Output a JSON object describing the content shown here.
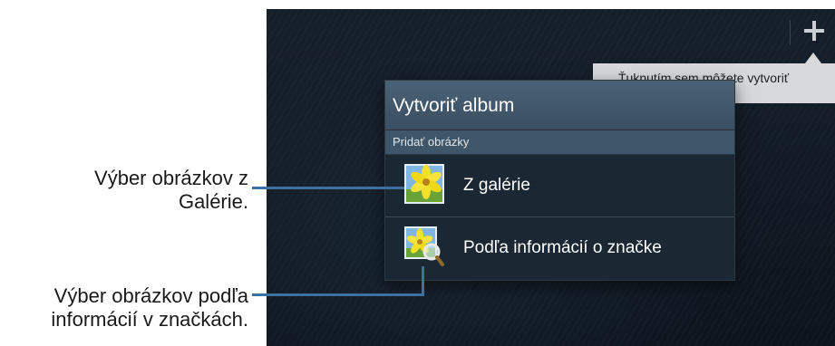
{
  "callouts": {
    "gallery": {
      "line1": "Výber obrázkov z",
      "line2": "Galérie."
    },
    "tags": {
      "line1": "Výber obrázkov podľa",
      "line2": "informácií v značkách."
    }
  },
  "screen": {
    "tooltip_text": "Ťuknutím sem môžete vytvoriť",
    "add_icon": "plus-icon"
  },
  "dialog": {
    "title": "Vytvoriť album",
    "section": "Pridať obrázky",
    "options": [
      {
        "label": "Z galérie",
        "icon": "gallery-flower-icon"
      },
      {
        "label": "Podľa informácií o značke",
        "icon": "tag-search-icon"
      }
    ]
  },
  "colors": {
    "leader_line": "#3d6fa0",
    "dialog_header": "#4b6275",
    "tooltip_bg": "#d6d9dc"
  }
}
